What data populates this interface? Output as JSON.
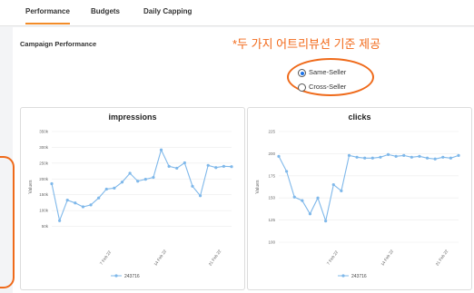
{
  "tabs": [
    {
      "label": "Performance",
      "active": true
    },
    {
      "label": "Budgets",
      "active": false
    },
    {
      "label": "Daily Capping",
      "active": false
    }
  ],
  "section_title": "Campaign Performance",
  "annotation": "*두 가지 어트리뷰션 기준 제공",
  "radio_options": [
    {
      "label": "Same-Seller",
      "checked": true
    },
    {
      "label": "Cross-Seller",
      "checked": false
    }
  ],
  "colors": {
    "accent": "#f28c28",
    "annotation": "#ef6a1a",
    "series": "#7fb8ea",
    "radio_selected": "#1a73e8"
  },
  "chart_data": [
    {
      "type": "line",
      "title": "impressions",
      "ylabel": "Values",
      "ylim": [
        0,
        350000
      ],
      "yticks": [
        50000,
        100000,
        150000,
        200000,
        250000,
        300000,
        350000
      ],
      "ytick_labels": [
        "50k",
        "100k",
        "150k",
        "200k",
        "250k",
        "300k",
        "350k"
      ],
      "xtick_labels": [
        {
          "index": 7,
          "label": "7 Feb 22"
        },
        {
          "index": 14,
          "label": "14 Feb 22"
        },
        {
          "index": 21,
          "label": "21 Feb 22"
        }
      ],
      "series": [
        {
          "name": "243716",
          "values": [
            185000,
            68000,
            133000,
            124000,
            112000,
            118000,
            140000,
            168000,
            171000,
            190000,
            218000,
            193000,
            199000,
            205000,
            292000,
            240000,
            234000,
            251000,
            177000,
            147000,
            243000,
            236000,
            240000,
            239000
          ]
        }
      ],
      "legend": "bottom"
    },
    {
      "type": "line",
      "title": "clicks",
      "ylabel": "Values",
      "ylim": [
        100,
        225
      ],
      "yticks": [
        100,
        125,
        150,
        175,
        200,
        225
      ],
      "ytick_labels": [
        "100",
        "125",
        "150",
        "175",
        "200",
        "225"
      ],
      "xtick_labels": [
        {
          "index": 7,
          "label": "7 Feb 22"
        },
        {
          "index": 14,
          "label": "14 Feb 22"
        },
        {
          "index": 21,
          "label": "21 Feb 22"
        }
      ],
      "series": [
        {
          "name": "243716",
          "values": [
            197,
            180,
            151,
            147,
            132,
            150,
            124,
            165,
            158,
            198,
            196,
            195,
            195,
            196,
            199,
            197,
            198,
            196,
            197,
            195,
            194,
            196,
            195,
            198
          ]
        }
      ],
      "legend": "bottom"
    }
  ]
}
